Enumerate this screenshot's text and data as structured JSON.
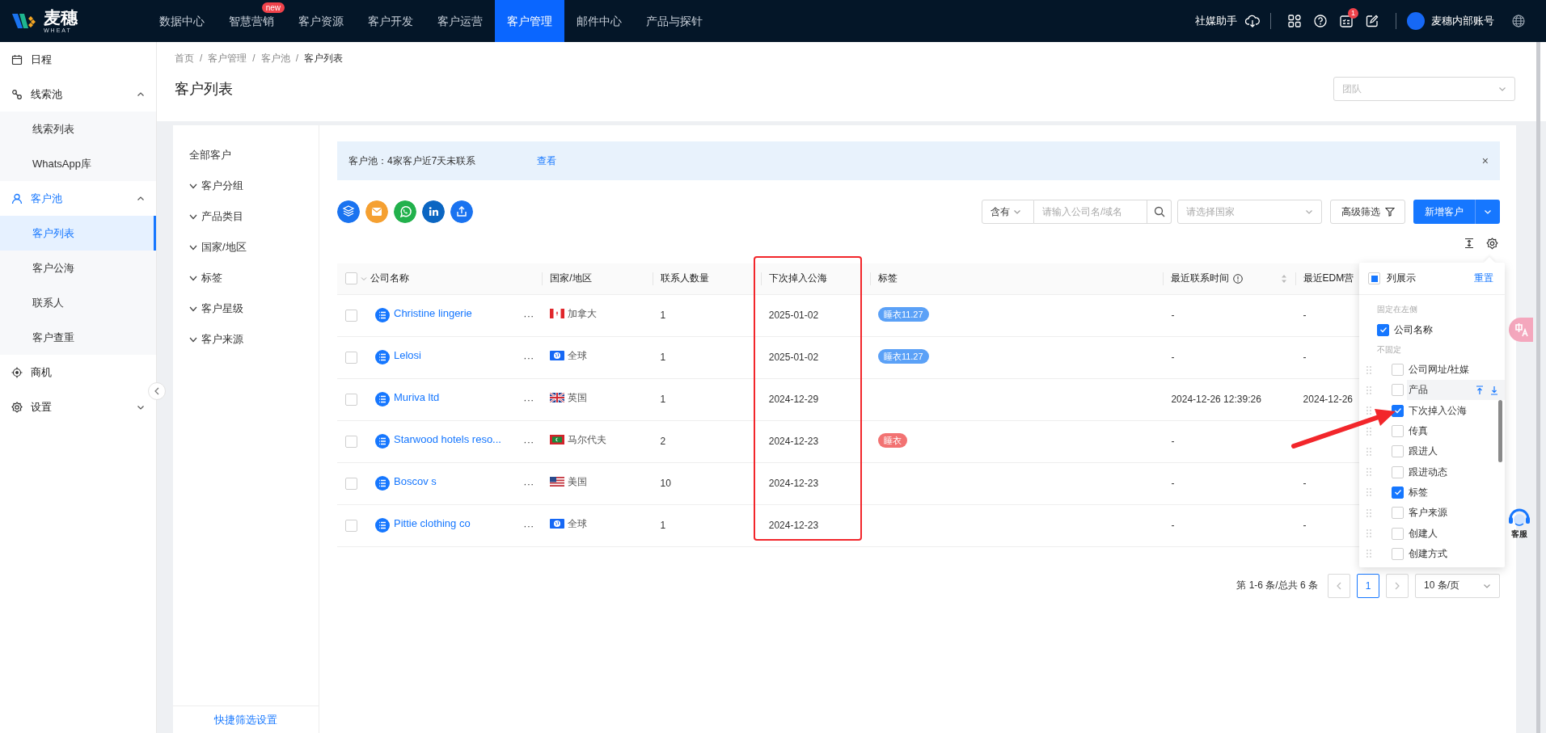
{
  "logo": {
    "name": "麦穗",
    "tagline": "WHEAT"
  },
  "nav": [
    {
      "label": "数据中心",
      "selected": false
    },
    {
      "label": "智慧营销",
      "selected": false,
      "badge": "new"
    },
    {
      "label": "客户资源",
      "selected": false
    },
    {
      "label": "客户开发",
      "selected": false
    },
    {
      "label": "客户运营",
      "selected": false
    },
    {
      "label": "客户管理",
      "selected": true
    },
    {
      "label": "邮件中心",
      "selected": false
    },
    {
      "label": "产品与探针",
      "selected": false
    }
  ],
  "topbar_right": {
    "assistant": "社媒助手",
    "notification_count": "1",
    "account": "麦穗内部账号"
  },
  "sidebar": {
    "items": [
      {
        "label": "日程",
        "kind": "calendar",
        "selected": false
      },
      {
        "label": "线索池",
        "kind": "clue",
        "selected": false,
        "expanded": true,
        "children": [
          {
            "label": "线索列表",
            "selected": false
          },
          {
            "label": "WhatsApp库",
            "selected": false
          }
        ]
      },
      {
        "label": "客户池",
        "kind": "user",
        "selected": true,
        "expanded": true,
        "children": [
          {
            "label": "客户列表",
            "selected": true
          },
          {
            "label": "客户公海",
            "selected": false
          },
          {
            "label": "联系人",
            "selected": false
          },
          {
            "label": "客户查重",
            "selected": false
          }
        ]
      },
      {
        "label": "商机",
        "kind": "target",
        "selected": false
      },
      {
        "label": "设置",
        "kind": "gear",
        "selected": false,
        "expanded": false
      }
    ]
  },
  "breadcrumb": [
    {
      "label": "首页",
      "separator": "/"
    },
    {
      "label": "客户管理",
      "separator": "/"
    },
    {
      "label": "客户池",
      "separator": "/"
    },
    {
      "label": "客户列表"
    }
  ],
  "page_title": "客户列表",
  "team_select": {
    "placeholder": "团队"
  },
  "filter_panel": {
    "items": [
      {
        "label": "全部客户",
        "expandable": false
      },
      {
        "label": "客户分组",
        "expandable": true
      },
      {
        "label": "产品类目",
        "expandable": true
      },
      {
        "label": "国家/地区",
        "expandable": true
      },
      {
        "label": "标签",
        "expandable": true
      },
      {
        "label": "客户星级",
        "expandable": true
      },
      {
        "label": "客户来源",
        "expandable": true
      }
    ],
    "footer_link": "快捷筛选设置"
  },
  "alert": {
    "text": "客户池：4家客户近7天未联系",
    "link": "查看",
    "close": "×"
  },
  "quick_actions": [
    {
      "kind": "layers",
      "color": "#1a73f0"
    },
    {
      "kind": "mail",
      "color": "#f5a031"
    },
    {
      "kind": "whatsapp",
      "color": "#22b14c"
    },
    {
      "kind": "linkedin",
      "color": "#0b66c2"
    },
    {
      "kind": "share",
      "color": "#1a73f0"
    }
  ],
  "search": {
    "match_mode": "含有",
    "placeholder": "请输入公司名/域名",
    "country_placeholder": "请选择国家"
  },
  "buttons": {
    "advanced_filter": "高级筛选",
    "add_customer": "新增客户"
  },
  "table": {
    "all_selected": false,
    "columns": [
      "公司名称",
      "国家/地区",
      "联系人数量",
      "下次掉入公海",
      "标签",
      "最近联系时间",
      "最近EDM营"
    ],
    "rows": [
      {
        "selected": false,
        "company": "Christine lingerie",
        "more": "···",
        "kind": "ca",
        "country": "加拿大",
        "contacts": "1",
        "next_pool_date": "2025-01-02",
        "tags": [
          {
            "label": "睡衣11.27",
            "color": "#5ba1f7"
          }
        ],
        "last_contact": "-",
        "last_edm": "-"
      },
      {
        "selected": false,
        "company": "Lelosi",
        "more": "···",
        "kind": "globe",
        "country": "全球",
        "contacts": "1",
        "next_pool_date": "2025-01-02",
        "tags": [
          {
            "label": "睡衣11.27",
            "color": "#5ba1f7"
          }
        ],
        "last_contact": "-",
        "last_edm": "-"
      },
      {
        "selected": false,
        "company": "Muriva ltd",
        "more": "···",
        "kind": "gb",
        "country": "英国",
        "contacts": "1",
        "next_pool_date": "2024-12-29",
        "last_contact": "2024-12-26 12:39:26",
        "last_edm": "2024-12-26"
      },
      {
        "selected": false,
        "company": "Starwood hotels reso...",
        "more": "···",
        "kind": "mv",
        "country": "马尔代夫",
        "contacts": "2",
        "next_pool_date": "2024-12-23",
        "tags": [
          {
            "label": "睡衣",
            "color": "#f27272"
          }
        ],
        "last_contact": "-"
      },
      {
        "selected": false,
        "company": "Boscov s",
        "more": "···",
        "kind": "us",
        "country": "美国",
        "contacts": "10",
        "next_pool_date": "2024-12-23",
        "last_contact": "-",
        "last_edm": "-"
      },
      {
        "selected": false,
        "company": "Pittie clothing co",
        "more": "···",
        "kind": "globe",
        "country": "全球",
        "contacts": "1",
        "next_pool_date": "2024-12-23",
        "last_contact": "-",
        "last_edm": "-"
      }
    ]
  },
  "pagination": {
    "summary": "第 1-6 条/总共 6 条",
    "pages": [
      {
        "label": "1",
        "selected": true
      }
    ],
    "page_size": "10 条/页"
  },
  "column_settings": {
    "title": "列展示",
    "indeterminate": true,
    "reset": "重置",
    "fixed_label": "固定在左侧",
    "fixed": [
      {
        "label": "公司名称",
        "checked": true
      }
    ],
    "unfixed_label": "不固定",
    "unfixed": [
      {
        "label": "公司网址/社媒",
        "checked": false,
        "hovered": false
      },
      {
        "label": "产品",
        "checked": false,
        "hovered": true
      },
      {
        "label": "下次掉入公海",
        "checked": true,
        "hovered": false
      },
      {
        "label": "传真",
        "checked": false,
        "hovered": false
      },
      {
        "label": "跟进人",
        "checked": false,
        "hovered": false
      },
      {
        "label": "跟进动态",
        "checked": false,
        "hovered": false
      },
      {
        "label": "标签",
        "checked": true,
        "hovered": false
      },
      {
        "label": "客户来源",
        "checked": false,
        "hovered": false
      },
      {
        "label": "创建人",
        "checked": false,
        "hovered": false
      },
      {
        "label": "创建方式",
        "checked": false,
        "hovered": false
      }
    ]
  },
  "support": {
    "label": "客服"
  }
}
